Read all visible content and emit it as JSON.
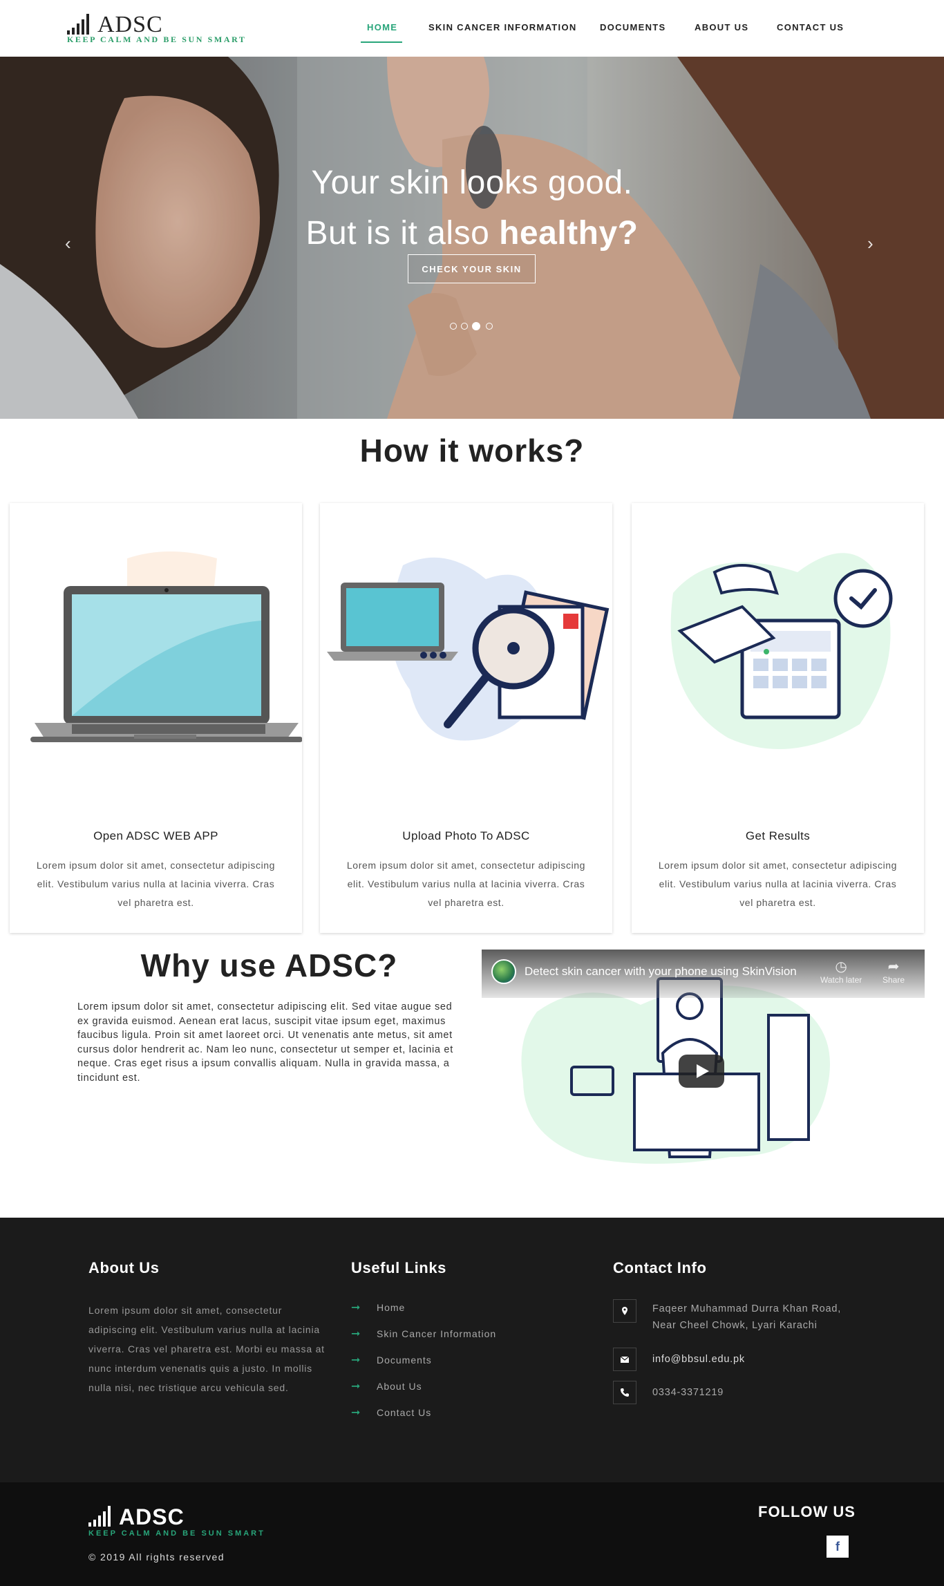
{
  "brand": {
    "name": "ADSC",
    "tagline": "KEEP CALM AND BE SUN SMART",
    "accent": "#28a57a"
  },
  "nav": {
    "items": [
      {
        "label": "HOME",
        "active": true
      },
      {
        "label": "SKIN CANCER INFORMATION",
        "active": false
      },
      {
        "label": "DOCUMENTS",
        "active": false
      },
      {
        "label": "ABOUT US",
        "active": false
      },
      {
        "label": "CONTACT US",
        "active": false
      }
    ]
  },
  "hero": {
    "line1": "Your skin looks good.",
    "line2_prefix": "But is it also ",
    "line2_bold": "healthy?",
    "button": "CHECK YOUR SKIN",
    "prev_icon": "chevron-left-icon",
    "next_icon": "chevron-right-icon",
    "slides": 4,
    "active_slide": 3
  },
  "how": {
    "title": "How it works?",
    "cards": [
      {
        "title": "Open ADSC WEB APP",
        "text": "Lorem ipsum dolor sit amet, consectetur adipiscing elit. Vestibulum varius nulla at lacinia viverra. Cras vel pharetra est.",
        "icon": "laptop-illustration"
      },
      {
        "title": "Upload Photo To ADSC",
        "text": "Lorem ipsum dolor sit amet, consectetur adipiscing elit. Vestibulum varius nulla at lacinia viverra. Cras vel pharetra est.",
        "icon": "magnifier-upload-illustration"
      },
      {
        "title": "Get Results",
        "text": "Lorem ipsum dolor sit amet, consectetur adipiscing elit. Vestibulum varius nulla at lacinia viverra. Cras vel pharetra est.",
        "icon": "results-calendar-illustration"
      }
    ]
  },
  "why": {
    "title": "Why use ADSC?",
    "text": "Lorem ipsum dolor sit amet, consectetur adipiscing elit. Sed vitae augue sed ex gravida euismod. Aenean erat lacus, suscipit vitae ipsum eget, maximus faucibus ligula. Proin sit amet laoreet orci. Ut venenatis ante metus, sit amet cursus dolor hendrerit ac. Nam leo nunc, consectetur ut semper et, lacinia et neque. Cras eget risus a ipsum convallis aliquam. Nulla in gravida massa, a tincidunt est.",
    "video": {
      "title": "Detect skin cancer with your phone using SkinVision",
      "watch_later": "Watch later",
      "share": "Share"
    }
  },
  "footer": {
    "about_heading": "About Us",
    "about_text": "Lorem ipsum dolor sit amet, consectetur adipiscing elit. Vestibulum varius nulla at lacinia viverra. Cras vel pharetra est. Morbi eu massa at nunc interdum venenatis quis a justo. In mollis nulla nisi, nec tristique arcu vehicula sed.",
    "links_heading": "Useful Links",
    "links": [
      "Home",
      "Skin Cancer Information",
      "Documents",
      "About Us",
      "Contact Us"
    ],
    "contact_heading": "Contact Info",
    "address": "Faqeer Muhammad Durra Khan Road, Near Cheel Chowk, Lyari Karachi",
    "email": "info@bbsul.edu.pk",
    "phone": "0334-3371219",
    "copyright": "© 2019 All rights reserved",
    "follow": "FOLLOW US",
    "social": "f"
  }
}
